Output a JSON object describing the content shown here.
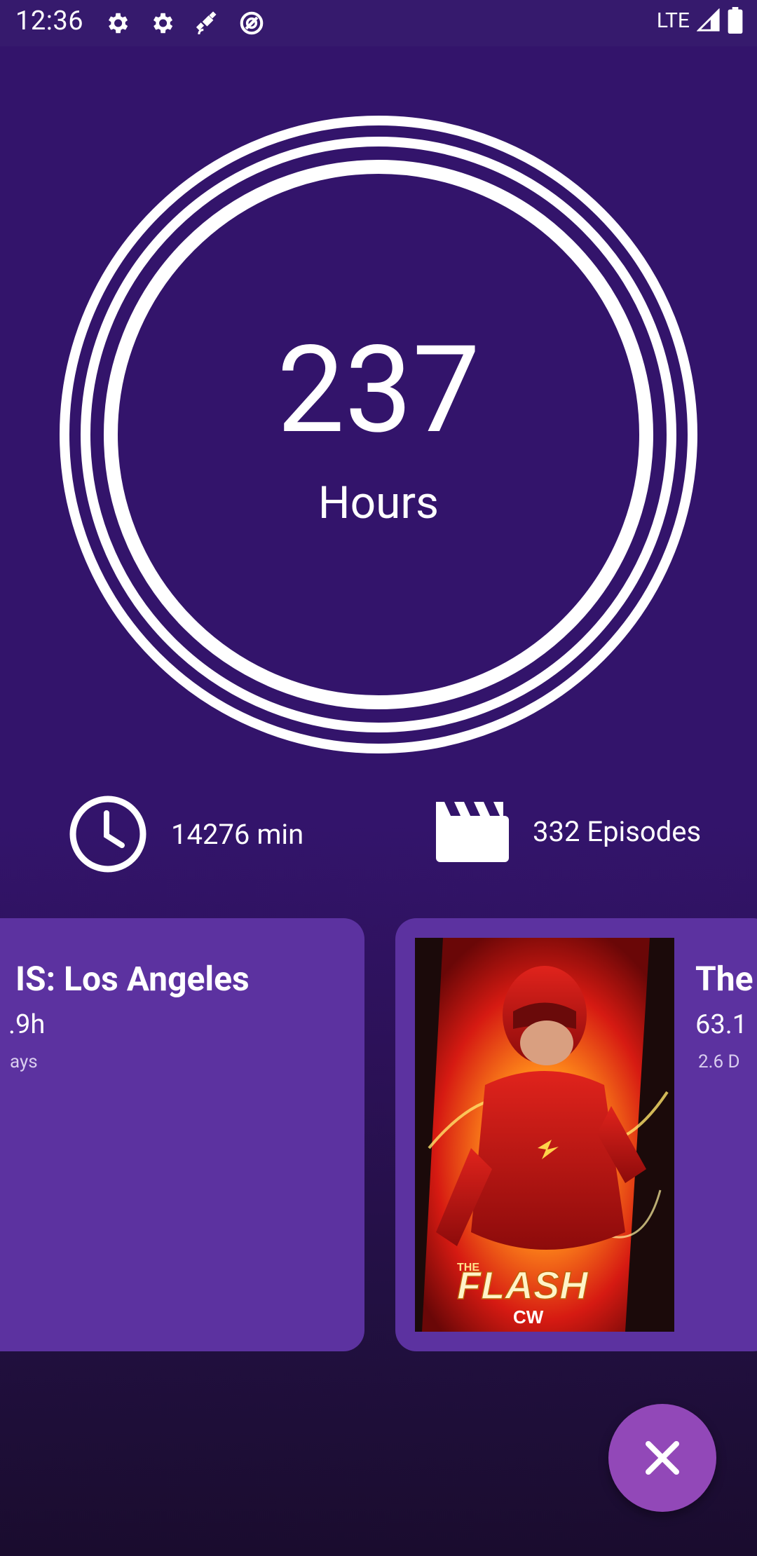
{
  "status_bar": {
    "time": "12:36",
    "network": "LTE",
    "icons": [
      "settings-icon",
      "settings-icon",
      "satellite-icon",
      "data-saver-icon",
      "signal-icon",
      "battery-icon"
    ]
  },
  "summary": {
    "total_hours": "237",
    "hours_label": "Hours"
  },
  "stats": {
    "minutes": "14276 min",
    "episodes": "332 Episodes"
  },
  "shows": [
    {
      "title": "IS: Los Angeles",
      "hours": ".9h",
      "days": "ays"
    },
    {
      "title": "The",
      "hours": "63.1",
      "days": "2.6 D",
      "poster_text": "FLASH",
      "poster_brand": "CW",
      "poster_prefix": "THE"
    }
  ],
  "fab": {
    "icon": "close-icon"
  },
  "colors": {
    "background": "#33146b",
    "status_bar": "#361a6d",
    "card": "#5c32a0",
    "fab": "#9248b8",
    "ring": "#ffffff"
  }
}
